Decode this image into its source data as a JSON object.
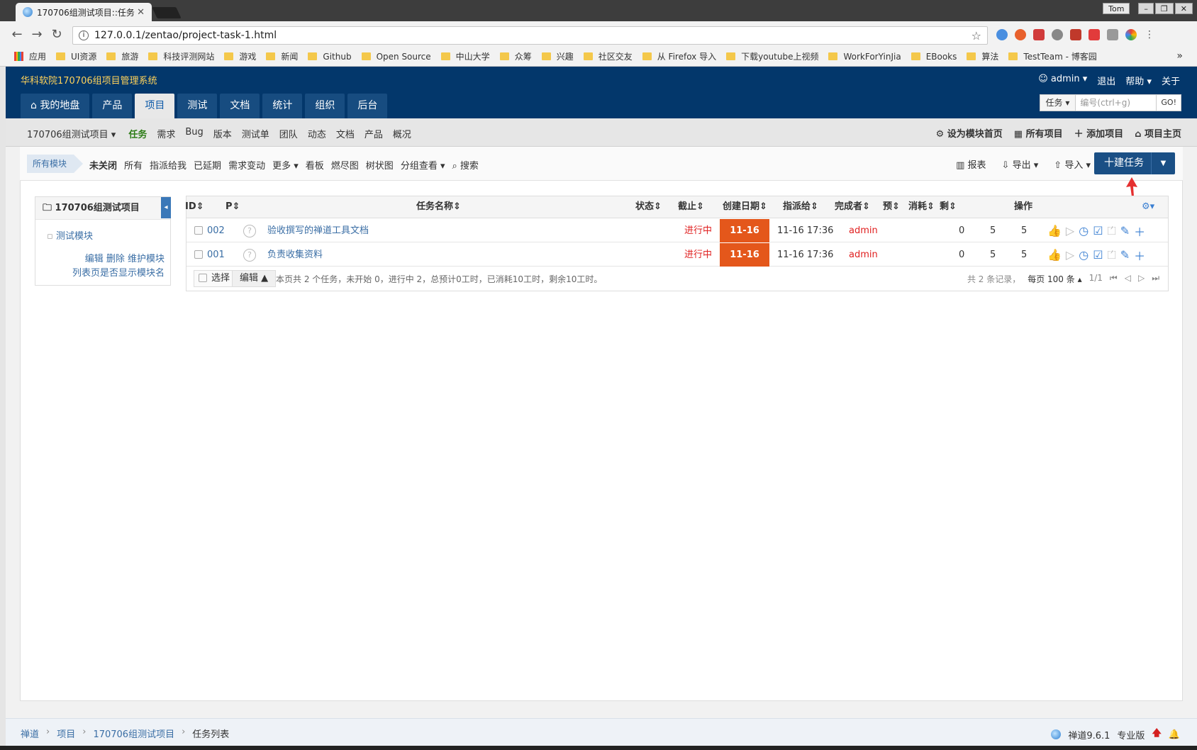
{
  "browser": {
    "tab_title": "170706组测试项目::任务",
    "url": "127.0.0.1/zentao/project-task-1.html",
    "window_user": "Tom",
    "bookmarks": [
      "应用",
      "UI资源",
      "旅游",
      "科技评测网站",
      "游戏",
      "新闻",
      "Github",
      "Open Source",
      "中山大学",
      "众筹",
      "兴趣",
      "社区交友",
      "从 Firefox 导入",
      "下载youtube上视频",
      "WorkForYinJia",
      "EBooks",
      "算法",
      "TestTeam - 博客园"
    ]
  },
  "header": {
    "brand": "华科软院170706组项目管理系统",
    "user": "admin",
    "logout": "退出",
    "help": "帮助",
    "about": "关于",
    "nav": [
      "我的地盘",
      "产品",
      "项目",
      "测试",
      "文档",
      "统计",
      "组织",
      "后台"
    ],
    "search_type": "任务",
    "search_placeholder": "编号(ctrl+g)",
    "search_go": "GO!"
  },
  "subnav": {
    "project": "170706组测试项目",
    "items": [
      "任务",
      "需求",
      "Bug",
      "版本",
      "测试单",
      "团队",
      "动态",
      "文档",
      "产品",
      "概况"
    ],
    "right": [
      "设为模块首页",
      "所有项目",
      "添加项目",
      "项目主页"
    ]
  },
  "featurebar": {
    "module": "所有模块",
    "filters": [
      "未关闭",
      "所有",
      "指派给我",
      "已延期",
      "需求变动",
      "更多",
      "看板",
      "燃尽图",
      "树状图",
      "分组查看",
      "搜索"
    ],
    "report": "报表",
    "export": "导出",
    "import": "导入",
    "create": "十建任务"
  },
  "side": {
    "title": "170706组测试项目",
    "module": "测试模块",
    "links1": "编辑 删除 维护模块",
    "links2": "列表页是否显示模块名"
  },
  "table": {
    "headers": [
      "ID",
      "P",
      "任务名称",
      "状态",
      "截止",
      "创建日期",
      "指派给",
      "完成者",
      "预",
      "消耗",
      "剩",
      "操作"
    ],
    "rows": [
      {
        "id": "002",
        "pri": "?",
        "name": "验收撰写的禅道工具文档",
        "status": "进行中",
        "deadline": "11-16",
        "created": "11-16 17:36",
        "assigned": "admin",
        "finished": "",
        "estimate": "0",
        "consumed": "5",
        "left": "5"
      },
      {
        "id": "001",
        "pri": "?",
        "name": "负责收集资料",
        "status": "进行中",
        "deadline": "11-16",
        "created": "11-16 17:36",
        "assigned": "admin",
        "finished": "",
        "estimate": "0",
        "consumed": "5",
        "left": "5"
      }
    ],
    "select_all": "选择",
    "edit": "编辑",
    "summary": "本页共 2 个任务，未开始 0，进行中 2，总预计0工时，已消耗10工时，剩余10工时。",
    "total": "共 2 条记录，",
    "per_page": "每页 100 条",
    "page": "1/1"
  },
  "footer": {
    "crumbs": [
      "禅道",
      "项目",
      "170706组测试项目",
      "任务列表"
    ],
    "version": "禅道9.6.1",
    "edition": "专业版"
  },
  "colors": {
    "header": "#03376b",
    "accent": "#1a4f85",
    "deadline": "#e4571b",
    "status": "#e02020"
  }
}
